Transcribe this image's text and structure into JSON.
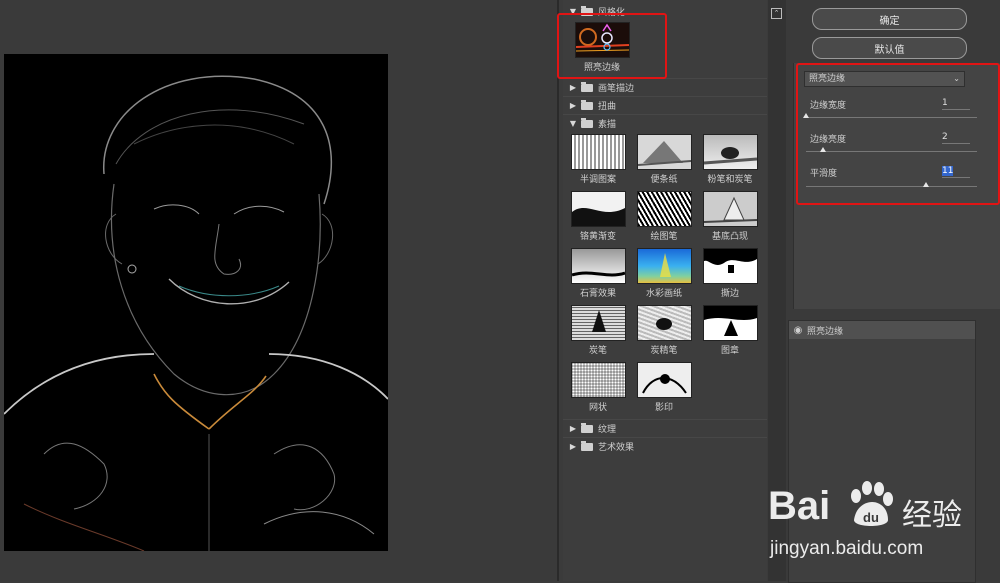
{
  "filter_gallery": {
    "categories": [
      {
        "label": "风格化",
        "expanded": true
      },
      {
        "label": "画笔描边",
        "expanded": false
      },
      {
        "label": "扭曲",
        "expanded": false
      },
      {
        "label": "素描",
        "expanded": true
      },
      {
        "label": "纹理",
        "expanded": false
      },
      {
        "label": "艺术效果",
        "expanded": false
      }
    ],
    "stylize_filters": [
      {
        "label": "照亮边缘",
        "selected": true
      }
    ],
    "sketch_filters": [
      {
        "label": "半调图案"
      },
      {
        "label": "便条纸"
      },
      {
        "label": "粉笔和炭笔"
      },
      {
        "label": "铬黄渐变"
      },
      {
        "label": "绘图笔"
      },
      {
        "label": "基底凸现"
      },
      {
        "label": "石膏效果"
      },
      {
        "label": "水彩画纸"
      },
      {
        "label": "撕边"
      },
      {
        "label": "炭笔"
      },
      {
        "label": "炭精笔"
      },
      {
        "label": "图章"
      },
      {
        "label": "网状"
      },
      {
        "label": "影印"
      }
    ]
  },
  "buttons": {
    "ok": "确定",
    "default": "默认值"
  },
  "settings": {
    "filter_select": "照亮边缘",
    "sliders": [
      {
        "label": "边缘宽度",
        "value": "1",
        "fraction": 0.0
      },
      {
        "label": "边缘亮度",
        "value": "2",
        "fraction": 0.1
      },
      {
        "label": "平滑度",
        "value": "11",
        "fraction": 0.7
      }
    ]
  },
  "layers": {
    "item_label": "照亮边缘"
  },
  "watermark": {
    "brand_left": "Bai",
    "brand_right": "经验",
    "url": "jingyan.baidu.com"
  },
  "colors": {
    "highlight_red": "#e11414",
    "background": "#3b3b3b"
  }
}
